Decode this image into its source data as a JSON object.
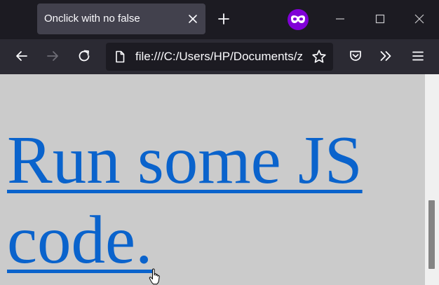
{
  "browser": {
    "tab": {
      "title": "Onclick with no false"
    },
    "url": "file:///C:/Users/HP/Documents/z"
  },
  "page": {
    "link_text": "Run some JS code."
  },
  "icons": {
    "tab_close": "close-icon",
    "new_tab": "plus-icon",
    "private": "private-browsing-icon",
    "minimize": "minimize-icon",
    "maximize": "maximize-icon",
    "window_close": "close-icon",
    "back": "arrow-left-icon",
    "forward": "arrow-right-icon",
    "reload": "reload-icon",
    "page": "page-icon",
    "bookmark": "star-icon",
    "pocket": "pocket-icon",
    "overflow": "chevrons-right-icon",
    "menu": "hamburger-menu-icon",
    "cursor": "hand-pointer-icon"
  },
  "colors": {
    "link": "#0a63cc",
    "page_background": "#cbcbcb",
    "private_badge": "#8000d7"
  }
}
